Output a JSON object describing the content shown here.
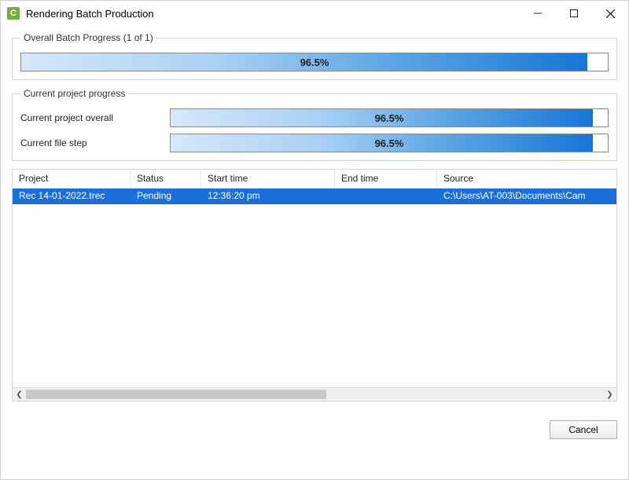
{
  "window": {
    "title": "Rendering Batch Production"
  },
  "overall": {
    "legend": "Overall Batch Progress (1 of 1)",
    "percent": 96.5,
    "percent_label": "96.5%"
  },
  "current": {
    "legend": "Current project progress",
    "overall_label": "Current project overall",
    "overall_percent": 96.5,
    "overall_percent_label": "96.5%",
    "step_label": "Current file step",
    "step_percent": 96.5,
    "step_percent_label": "96.5%"
  },
  "table": {
    "headers": {
      "project": "Project",
      "status": "Status",
      "start": "Start time",
      "end": "End time",
      "source": "Source"
    },
    "rows": [
      {
        "project": "Rec 14-01-2022.trec",
        "status": "Pending",
        "start": "12:36:20 pm",
        "end": "",
        "source": "C:\\Users\\AT-003\\Documents\\Cam"
      }
    ]
  },
  "buttons": {
    "cancel": "Cancel"
  }
}
